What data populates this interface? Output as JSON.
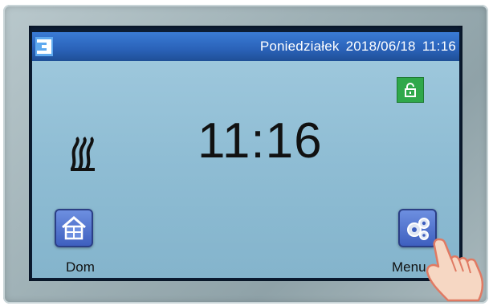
{
  "header": {
    "day": "Poniedziałek",
    "date": "2018/06/18",
    "time": "11:16"
  },
  "clock": {
    "time": "11:16"
  },
  "status": {
    "lock_icon": "unlocked-padlock-icon",
    "lock_color": "#2fa84a"
  },
  "mode": {
    "icon": "radiator-heating-icon"
  },
  "buttons": {
    "home": {
      "label": "Dom",
      "icon": "house-icon"
    },
    "menu": {
      "label": "Menu",
      "icon": "gears-icon"
    }
  },
  "colors": {
    "topbar": "#2a62b8",
    "background": "#8fbdd4",
    "tile": "#3e5fbf"
  }
}
